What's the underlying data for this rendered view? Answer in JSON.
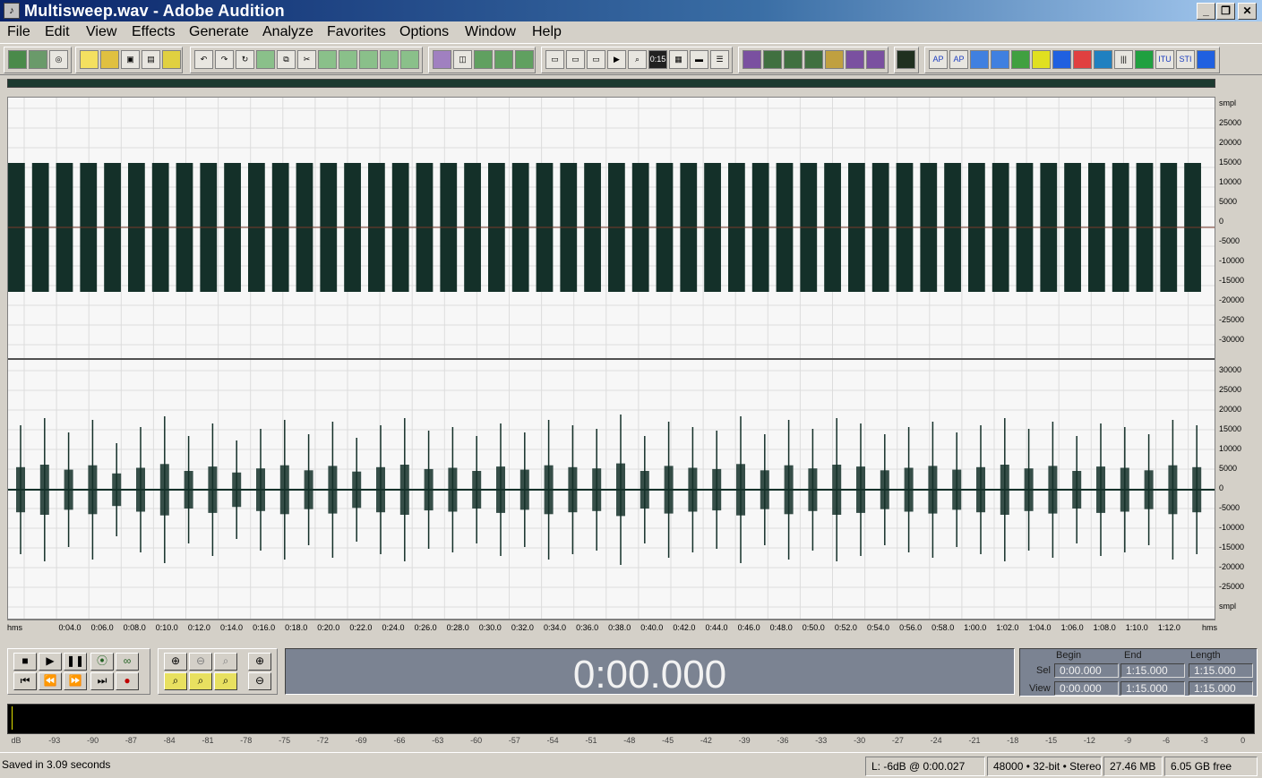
{
  "window": {
    "title": "Multisweep.wav - Adobe Audition",
    "icon": "audition-app-icon"
  },
  "menu": [
    "File",
    "Edit",
    "View",
    "Effects",
    "Generate",
    "Analyze",
    "Favorites",
    "Options",
    "Window",
    "Help"
  ],
  "vertical_ruler": {
    "top_channel": [
      "smpl",
      "25000",
      "20000",
      "15000",
      "10000",
      "5000",
      "0",
      "-5000",
      "-10000",
      "-15000",
      "-20000",
      "-25000",
      "-30000"
    ],
    "bottom_channel": [
      "30000",
      "25000",
      "20000",
      "15000",
      "10000",
      "5000",
      "0",
      "-5000",
      "-10000",
      "-15000",
      "-20000",
      "-25000",
      "smpl"
    ]
  },
  "time_ruler": [
    "hms",
    "0:04.0",
    "0:06.0",
    "0:08.0",
    "0:10.0",
    "0:12.0",
    "0:14.0",
    "0:16.0",
    "0:18.0",
    "0:20.0",
    "0:22.0",
    "0:24.0",
    "0:26.0",
    "0:28.0",
    "0:30.0",
    "0:32.0",
    "0:34.0",
    "0:36.0",
    "0:38.0",
    "0:40.0",
    "0:42.0",
    "0:44.0",
    "0:46.0",
    "0:48.0",
    "0:50.0",
    "0:52.0",
    "0:54.0",
    "0:56.0",
    "0:58.0",
    "1:00.0",
    "1:02.0",
    "1:04.0",
    "1:06.0",
    "1:08.0",
    "1:10.0",
    "1:12.0",
    "hms"
  ],
  "time_display": "0:00.000",
  "selection": {
    "headers": {
      "begin": "Begin",
      "end": "End",
      "length": "Length"
    },
    "sel": {
      "label": "Sel",
      "begin": "0:00.000",
      "end": "1:15.000",
      "length": "1:15.000"
    },
    "view": {
      "label": "View",
      "begin": "0:00.000",
      "end": "1:15.000",
      "length": "1:15.000"
    }
  },
  "meter_scale": [
    "dB",
    "-93",
    "-90",
    "-87",
    "-84",
    "-81",
    "-78",
    "-75",
    "-72",
    "-69",
    "-66",
    "-63",
    "-60",
    "-57",
    "-54",
    "-51",
    "-48",
    "-45",
    "-42",
    "-39",
    "-36",
    "-33",
    "-30",
    "-27",
    "-24",
    "-21",
    "-18",
    "-15",
    "-12",
    "-9",
    "-6",
    "-3",
    "0"
  ],
  "status": {
    "message": "Saved in 3.09 seconds",
    "level": "L: -6dB @   0:00.027",
    "format": "48000 • 32-bit • Stereo",
    "size": "27.46 MB",
    "disk": "6.05 GB free"
  },
  "colors": {
    "waveform": "#143029",
    "background": "#f7f7f7",
    "display": "#7b8392"
  }
}
